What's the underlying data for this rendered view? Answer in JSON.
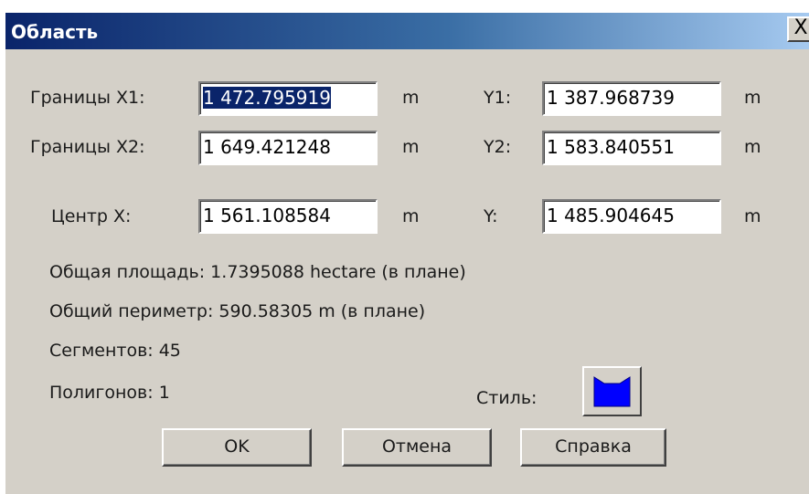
{
  "dialog": {
    "title": "Область",
    "close_label": "X"
  },
  "bounds": {
    "x1_label": "Границы X1:",
    "x1_value": "1 472.795919",
    "x1_unit": "m",
    "y1_label": "Y1:",
    "y1_value": "1 387.968739",
    "y1_unit": "m",
    "x2_label": "Границы X2:",
    "x2_value": "1 649.421248",
    "x2_unit": "m",
    "y2_label": "Y2:",
    "y2_value": "1 583.840551",
    "y2_unit": "m"
  },
  "center": {
    "x_label": "Центр X:",
    "x_value": "1 561.108584",
    "x_unit": "m",
    "y_label": "Y:",
    "y_value": "1 485.904645",
    "y_unit": "m"
  },
  "info": {
    "area": "Общая площадь:  1.7395088 hectare (в плане)",
    "perimeter": "Общий периметр:  590.58305 m (в плане)",
    "segments": "Сегментов:  45",
    "polygons": "Полигонов:  1",
    "style_label": "Стиль:"
  },
  "style": {
    "fill_color": "#0000ff"
  },
  "buttons": {
    "ok": "OK",
    "cancel": "Отмена",
    "help": "Справка"
  }
}
